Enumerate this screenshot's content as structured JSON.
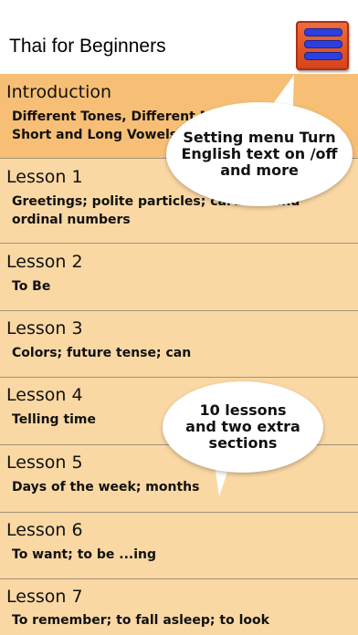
{
  "header": {
    "title": "Thai for Beginners",
    "menu_icon": "hamburger-menu-icon"
  },
  "lessons": [
    {
      "title": "Introduction",
      "subtitle": "Different Tones, Different Mouth Shapes, Short and Long Vowels; Similar Sounds"
    },
    {
      "title": "Lesson 1",
      "subtitle": "Greetings; polite particles; cardinal and ordinal numbers"
    },
    {
      "title": "Lesson 2",
      "subtitle": "To Be"
    },
    {
      "title": "Lesson 3",
      "subtitle": "Colors; future tense; can"
    },
    {
      "title": "Lesson 4",
      "subtitle": "Telling time"
    },
    {
      "title": "Lesson 5",
      "subtitle": "Days of the week; months"
    },
    {
      "title": "Lesson 6",
      "subtitle": "To want; to be ...ing"
    },
    {
      "title": "Lesson 7",
      "subtitle": "To remember; to fall asleep; to look"
    }
  ],
  "callouts": {
    "settings": "Setting menu Turn English text on /off and more",
    "lessons": "10 lessons and two extra sections"
  },
  "colors": {
    "header_bg": "#ffffff",
    "row_bg": "#fad8a4",
    "first_row_bg": "#f7bf76",
    "menu_button": "#e0522a",
    "menu_bars": "#2c3fe0"
  }
}
